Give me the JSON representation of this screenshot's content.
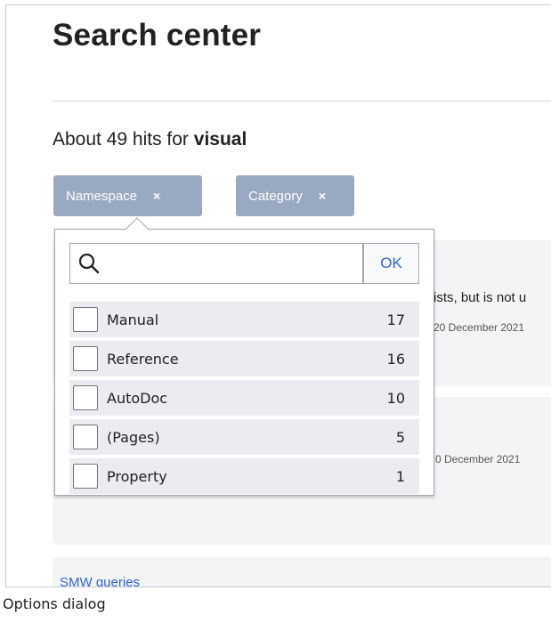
{
  "page": {
    "title": "Search center",
    "hits_prefix": "About 49 hits for ",
    "query": "visual"
  },
  "filters": [
    {
      "label": "Namespace",
      "remove": "×"
    },
    {
      "label": "Category",
      "remove": "×"
    }
  ],
  "dropdown": {
    "search_value": "",
    "ok_label": "OK",
    "options": [
      {
        "label": "Manual",
        "count": "17",
        "checked": false
      },
      {
        "label": "Reference",
        "count": "16",
        "checked": false
      },
      {
        "label": "AutoDoc",
        "count": "10",
        "checked": false
      },
      {
        "label": "(Pages)",
        "count": "5",
        "checked": false
      },
      {
        "label": "Property",
        "count": "1",
        "checked": false
      }
    ]
  },
  "results": {
    "snippet_1": "ists, but is not u",
    "date_1": "20 December 2021",
    "date_2": "0 December 2021",
    "date_2_sep": "|",
    "smw_link": "SMW queries"
  },
  "caption": "Options dialog",
  "colors": {
    "pill": "#9aa9c2",
    "card": "#f3f4f6",
    "row": "#eaecf0",
    "link": "#3366cc"
  }
}
